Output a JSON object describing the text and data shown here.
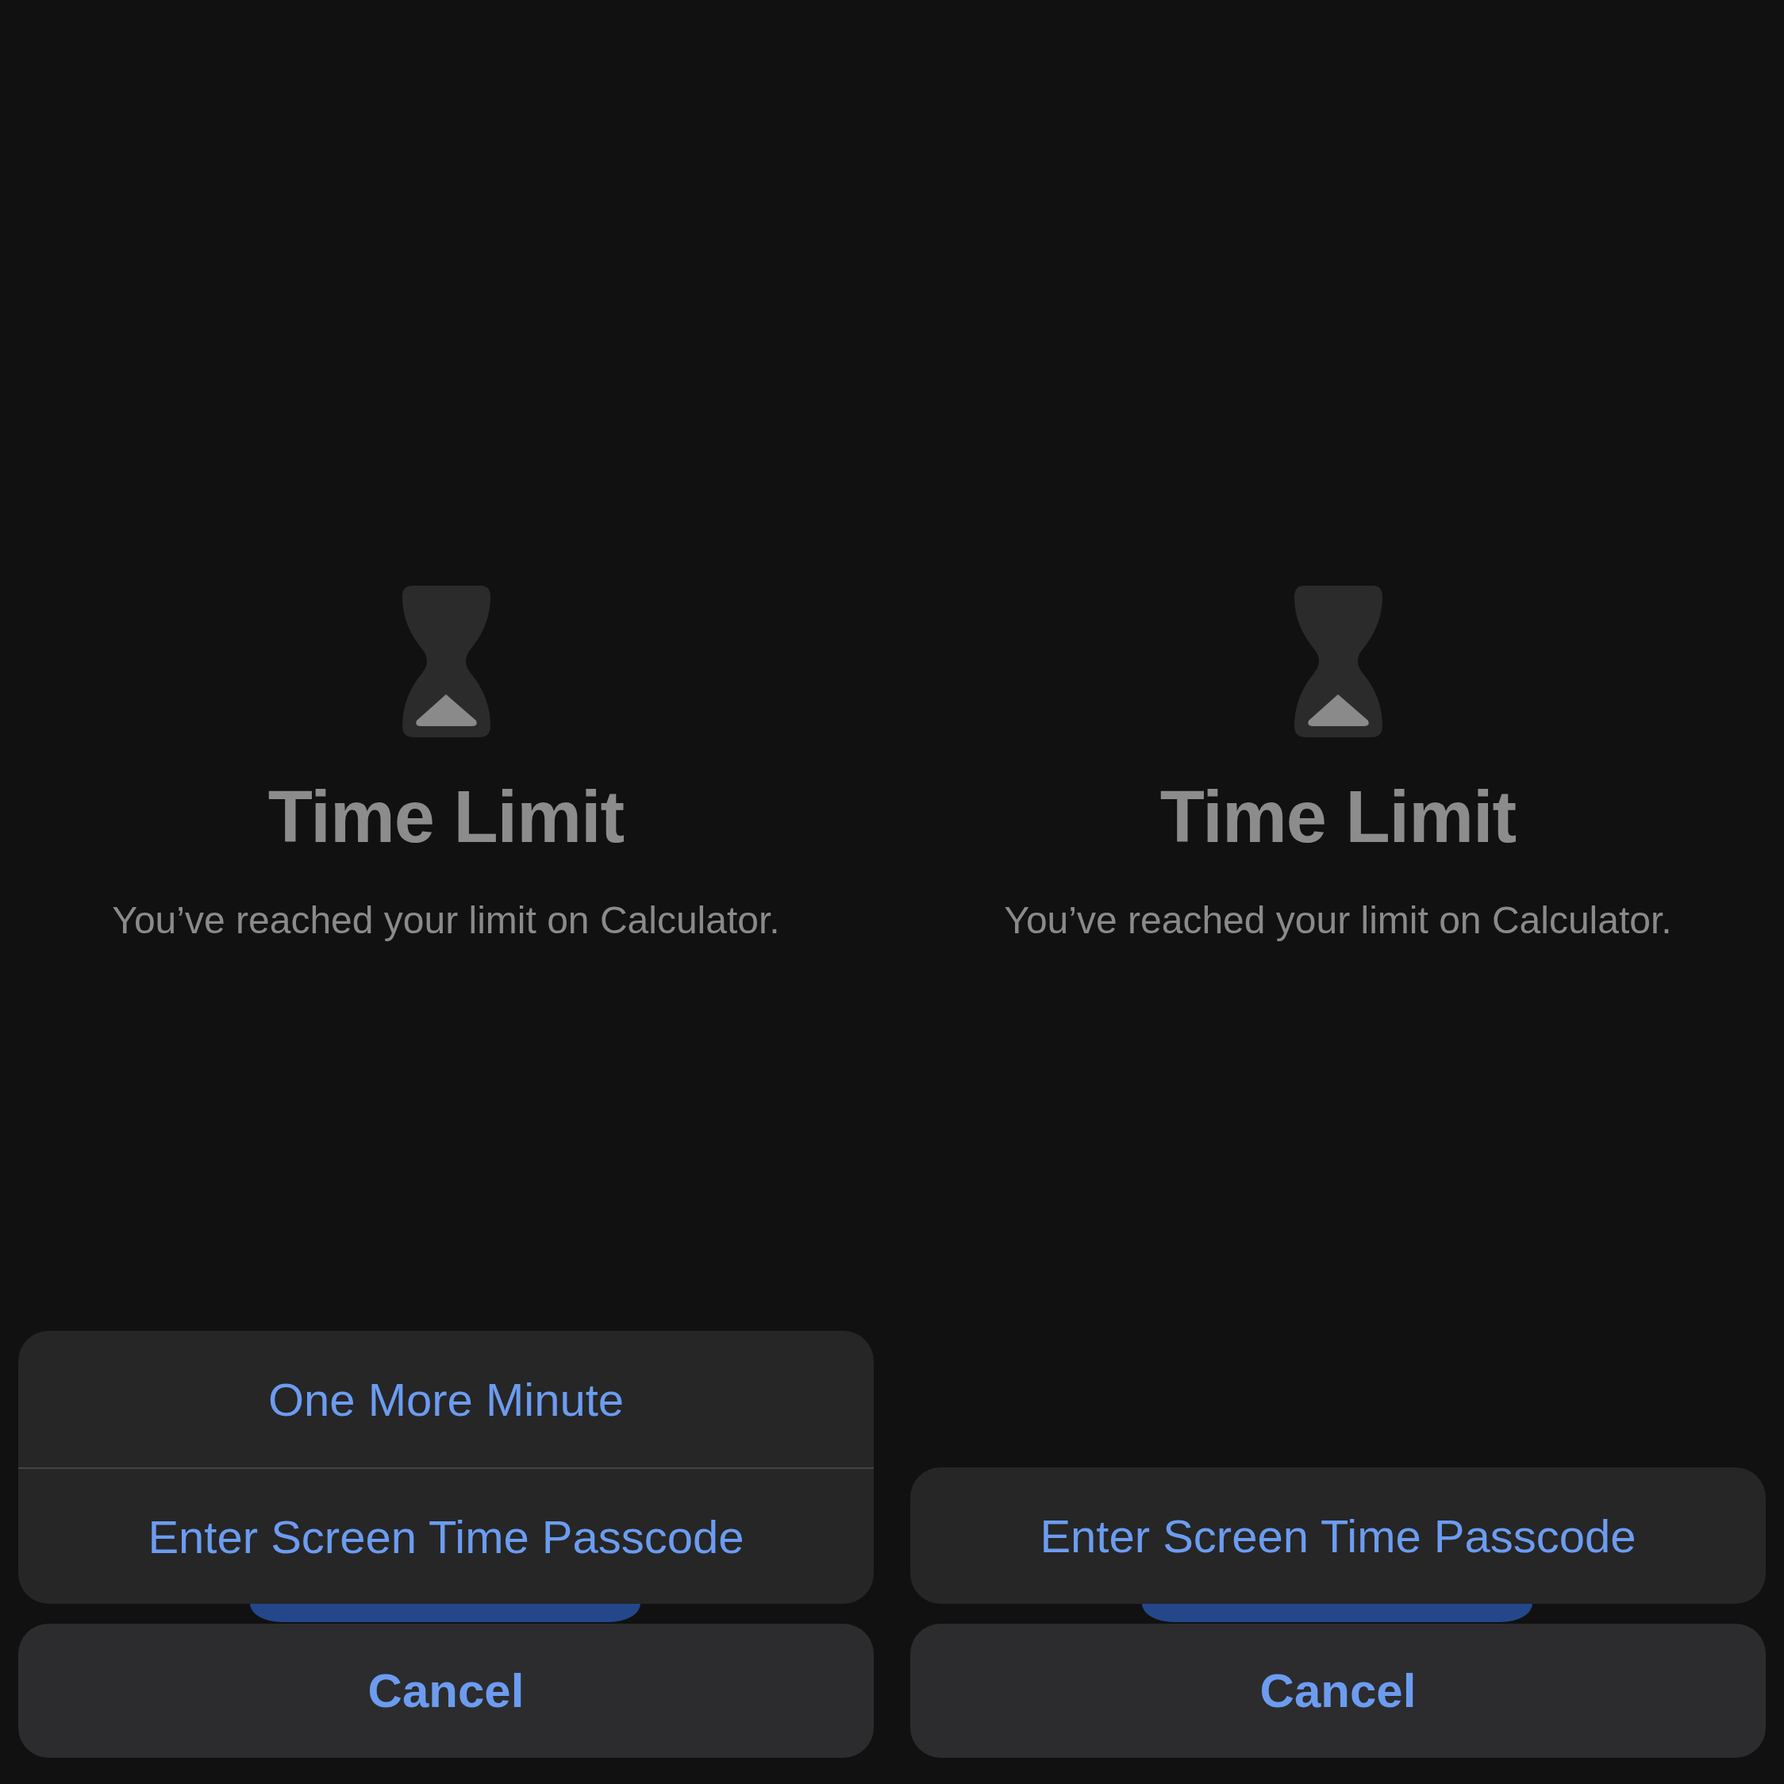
{
  "panels": [
    {
      "title": "Time Limit",
      "message": "You’ve reached your limit on Calculator.",
      "actions": [
        "One More Minute",
        "Enter Screen Time Passcode"
      ],
      "cancel": "Cancel"
    },
    {
      "title": "Time Limit",
      "message": "You’ve reached your limit on Calculator.",
      "actions": [
        "Enter Screen Time Passcode"
      ],
      "cancel": "Cancel"
    }
  ]
}
